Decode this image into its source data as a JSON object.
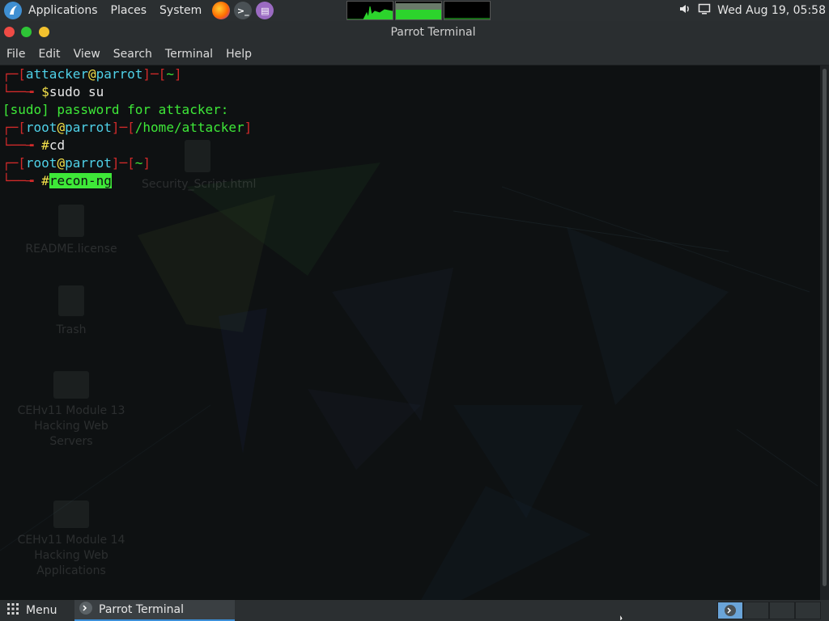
{
  "top_panel": {
    "menus": [
      "Applications",
      "Places",
      "System"
    ],
    "clock": "Wed Aug 19, 05:58",
    "icons": [
      "parrot-logo-icon",
      "firefox-icon",
      "terminal-icon",
      "text-editor-icon",
      "volume-icon",
      "display-icon"
    ]
  },
  "window": {
    "title": "Parrot Terminal",
    "menu": [
      "File",
      "Edit",
      "View",
      "Search",
      "Terminal",
      "Help"
    ]
  },
  "terminal": {
    "lines": [
      {
        "user": "attacker",
        "host": "parrot",
        "path": "~"
      },
      {
        "prompt": "$",
        "command": "sudo su"
      },
      {
        "output": "[sudo] password for attacker:"
      },
      {
        "user": "root",
        "host": "parrot",
        "path": "/home/attacker"
      },
      {
        "prompt": "#",
        "command": "cd"
      },
      {
        "user": "root",
        "host": "parrot",
        "path": "~"
      },
      {
        "prompt": "#",
        "command": "recon-ng"
      }
    ]
  },
  "desktop_ghosts": [
    "README.license",
    "Trash",
    "CEHv11 Module 13 Hacking Web Servers",
    "CEHv11 Module 14 Hacking Web Applications",
    "Security_Script.html"
  ],
  "bottom_panel": {
    "menu_label": "Menu",
    "task_label": "Parrot Terminal"
  },
  "colors": {
    "prompt_bracket": "#d12a2a",
    "user_host": "#4fd1e8",
    "at_sign": "#f3e04a",
    "text_green": "#3ee838"
  }
}
